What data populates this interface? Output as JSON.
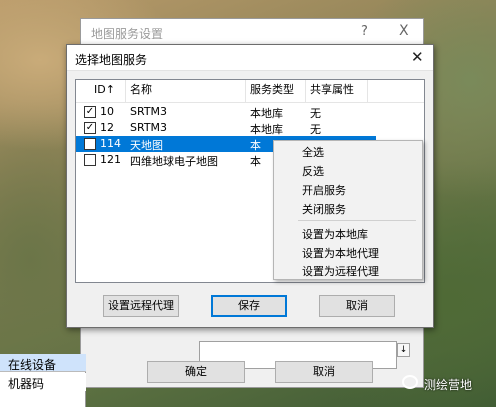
{
  "back_dialog": {
    "title": "地图服务设置",
    "help": "?",
    "close": "X",
    "ok_label": "确定",
    "cancel_label": "取消",
    "spin_label": "↓"
  },
  "left_panel": {
    "items": [
      "在线设备",
      "机器码"
    ]
  },
  "dialog": {
    "title": "选择地图服务",
    "close": "✕",
    "columns": [
      "ID↑",
      "名称",
      "服务类型",
      "共享属性"
    ],
    "rows": [
      {
        "checked": true,
        "check_mark": "✓",
        "id": "10",
        "name": "SRTM3",
        "type": "本地库",
        "share": "无"
      },
      {
        "checked": true,
        "check_mark": "✓",
        "id": "12",
        "name": "SRTM3",
        "type": "本地库",
        "share": "无"
      },
      {
        "checked": false,
        "check_mark": "",
        "id": "114",
        "name": "天地图",
        "type": "本",
        "share": ""
      },
      {
        "checked": false,
        "check_mark": "",
        "id": "121",
        "name": "四维地球电子地图",
        "type": "本",
        "share": ""
      }
    ],
    "remote_proxy_label": "设置远程代理",
    "save_label": "保存",
    "cancel_label": "取消"
  },
  "context_menu": {
    "items": [
      "全选",
      "反选",
      "开启服务",
      "关闭服务",
      "设置为本地库",
      "设置为本地代理",
      "设置为远程代理"
    ]
  },
  "watermark": "测绘营地"
}
